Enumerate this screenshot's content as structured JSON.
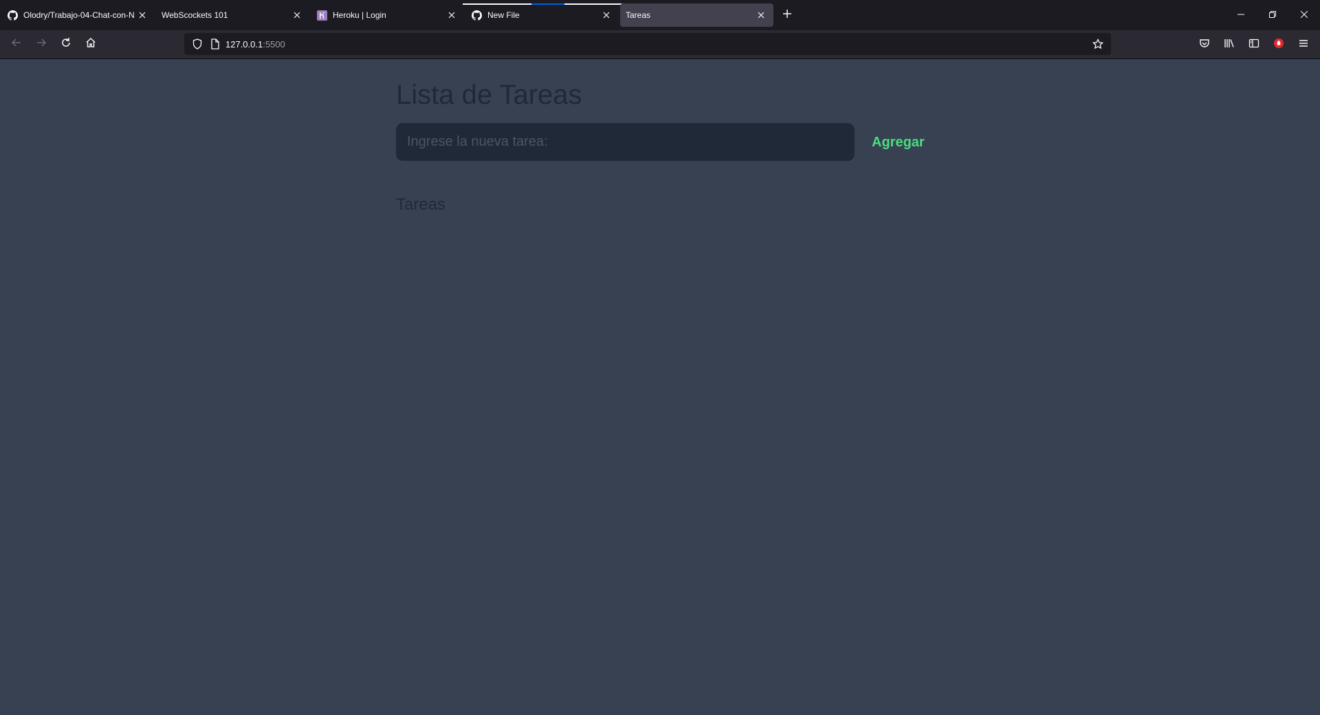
{
  "browser": {
    "tabs": [
      {
        "title": "Olodry/Trabajo-04-Chat-con-N",
        "icon": "github-icon",
        "active": false
      },
      {
        "title": "WebScockets 101",
        "icon": "none",
        "active": false
      },
      {
        "title": "Heroku | Login",
        "icon": "heroku-icon",
        "active": false
      },
      {
        "title": "New File",
        "icon": "github-icon",
        "active": false
      },
      {
        "title": "Tareas",
        "icon": "none",
        "active": true
      }
    ],
    "url": {
      "host": "127.0.0.1",
      "port": ":5500"
    }
  },
  "page": {
    "title": "Lista de Tareas",
    "input_placeholder": "Ingrese la nueva tarea:",
    "add_button_label": "Agregar",
    "section_title": "Tareas"
  },
  "colors": {
    "page_background": "#374151",
    "input_background": "#1f2937",
    "heading_text": "#1f2937",
    "add_button_text": "#4ade80"
  }
}
